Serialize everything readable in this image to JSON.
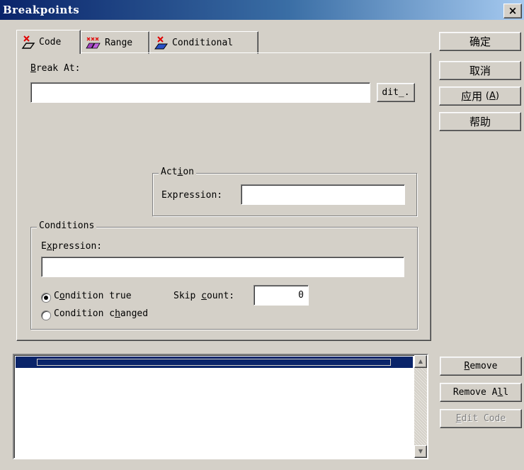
{
  "window": {
    "title": "Breakpoints",
    "close_glyph": "×"
  },
  "tabs": [
    {
      "label": "Code",
      "icon": "code-breakpoint-icon",
      "active": true
    },
    {
      "label": "Range",
      "icon": "range-breakpoint-icon",
      "active": false
    },
    {
      "label": "Conditional",
      "icon": "conditional-breakpoint-icon",
      "active": false
    }
  ],
  "code_tab": {
    "break_at_label": "Break At:",
    "break_at_mnemonic": "B",
    "break_at_value": "",
    "edit_button": "dit_."
  },
  "action_group": {
    "legend": "Action",
    "legend_mnemonic": "i",
    "expression_label": "Expression:",
    "expression_value": ""
  },
  "conditions_group": {
    "legend": "Conditions",
    "expression_label": "Expression:",
    "expression_mnemonic": "x",
    "expression_value": "",
    "radio_true_label": "Condition true",
    "radio_true_mnemonic": "o",
    "radio_true_selected": true,
    "radio_changed_label": "Condition changed",
    "radio_changed_mnemonic": "h",
    "radio_changed_selected": false,
    "skip_count_label": "Skip count:",
    "skip_count_mnemonic": "c",
    "skip_count_value": "0"
  },
  "dialog_buttons": {
    "ok": "确定",
    "cancel": "取消",
    "apply": "应用",
    "apply_key": "(A)",
    "help": "帮助"
  },
  "list_buttons": {
    "remove": "Remove",
    "remove_all": "Remove All",
    "edit_code": "Edit Code",
    "edit_code_enabled": false
  },
  "breakpoint_list": {
    "rows": [
      ""
    ],
    "selected_index": 0
  },
  "colors": {
    "face": "#d4d0c8",
    "title_start": "#0a246a",
    "title_end": "#a6caf0",
    "selection": "#0a246a"
  }
}
